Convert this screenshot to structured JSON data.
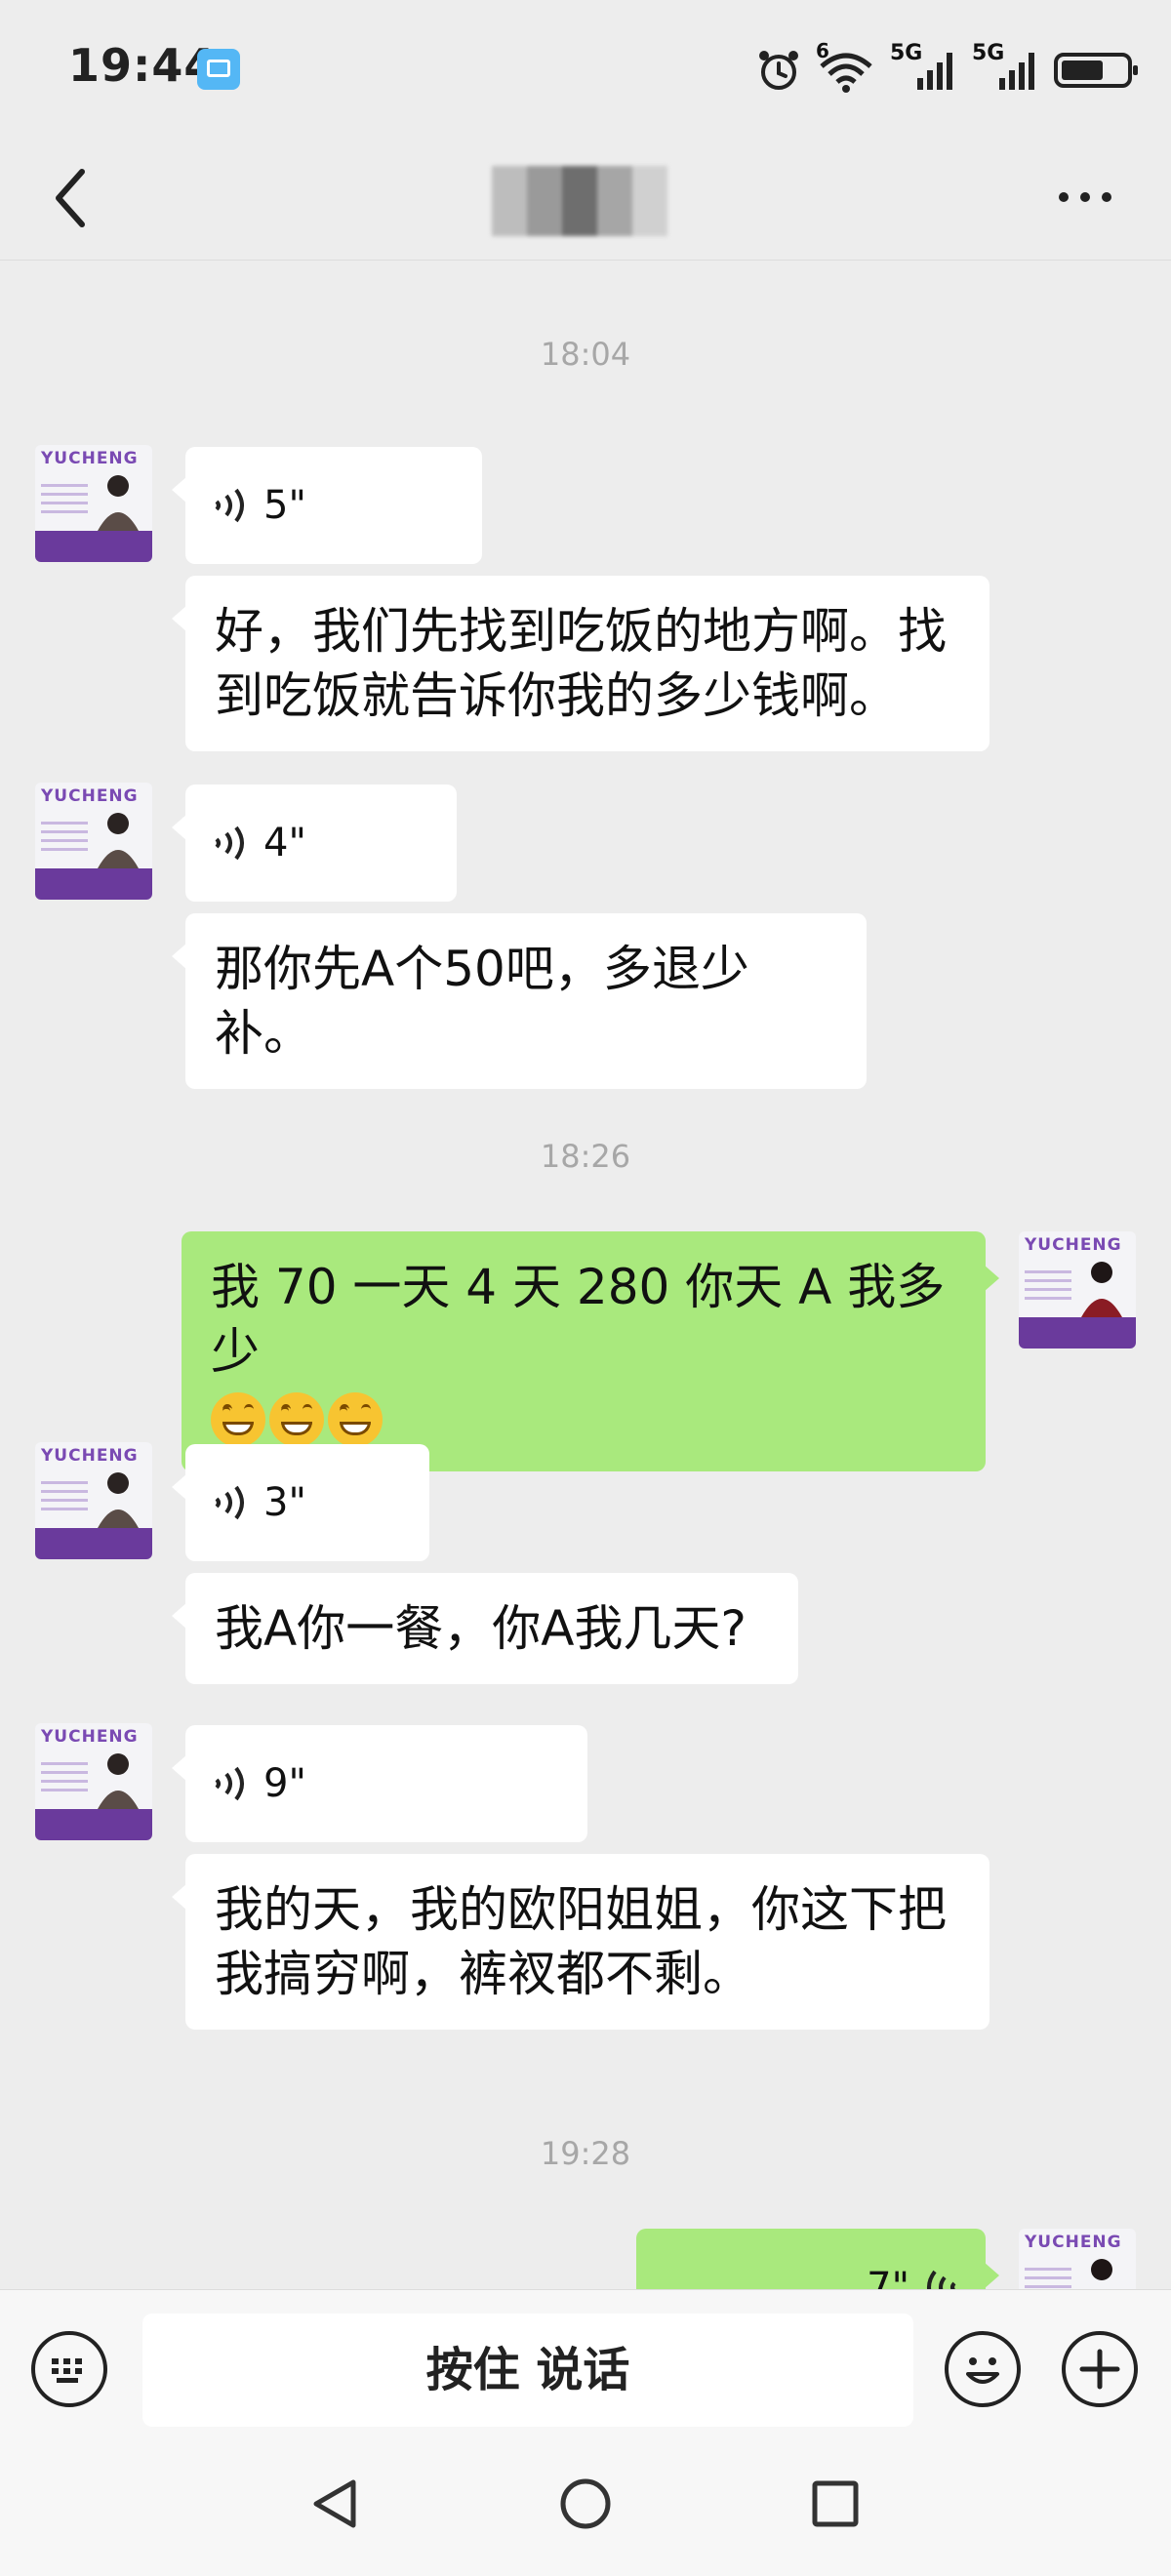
{
  "status_bar": {
    "time": "19:44",
    "signal_1_label": "5G",
    "signal_2_label": "5G",
    "wifi_label": "6",
    "icons": [
      "book-app-icon",
      "alarm-icon",
      "wifi-icon",
      "signal-icon",
      "battery-icon"
    ]
  },
  "nav": {
    "title_blurred": true,
    "icons": [
      "back-chevron-icon",
      "more-dots-icon"
    ]
  },
  "chat": {
    "timestamps": [
      "18:04",
      "18:26",
      "19:28"
    ],
    "messages": [
      {
        "side": "in",
        "type": "voice",
        "duration": "5\""
      },
      {
        "side": "in",
        "type": "text",
        "lines": [
          "好，我们先找到吃饭的地方啊。找",
          "到吃饭就告诉你我的多少钱啊。"
        ]
      },
      {
        "side": "in",
        "type": "voice",
        "duration": "4\""
      },
      {
        "side": "in",
        "type": "text",
        "lines": [
          "那你先A个50吧，多退少补。"
        ]
      },
      {
        "side": "out",
        "type": "text",
        "lines": [
          "我 70 一天 4 天 280 你天 A 我多少"
        ],
        "emoji_count": 3
      },
      {
        "side": "in",
        "type": "voice",
        "duration": "3\""
      },
      {
        "side": "in",
        "type": "text",
        "lines": [
          "我A你一餐，你A我几天?"
        ]
      },
      {
        "side": "in",
        "type": "voice",
        "duration": "9\""
      },
      {
        "side": "in",
        "type": "text",
        "lines": [
          "我的天，我的欧阳姐姐，你这下把",
          "我搞穷啊，裤衩都不剩。"
        ]
      },
      {
        "side": "out",
        "type": "voice",
        "duration": "7\""
      }
    ],
    "avatar_logo": "YUCHENG"
  },
  "input_bar": {
    "hold_to_talk": "按住 说话",
    "icons": [
      "keyboard-icon",
      "emoji-icon",
      "plus-icon"
    ]
  },
  "system_nav": {
    "icons": [
      "nav-back-icon",
      "nav-home-icon",
      "nav-recents-icon"
    ]
  },
  "colors": {
    "background": "#ededed",
    "incoming_bubble": "#ffffff",
    "outgoing_bubble": "#a9e97d",
    "avatar_accent": "#6a3a9c",
    "timestamp": "#a7a7a7"
  }
}
